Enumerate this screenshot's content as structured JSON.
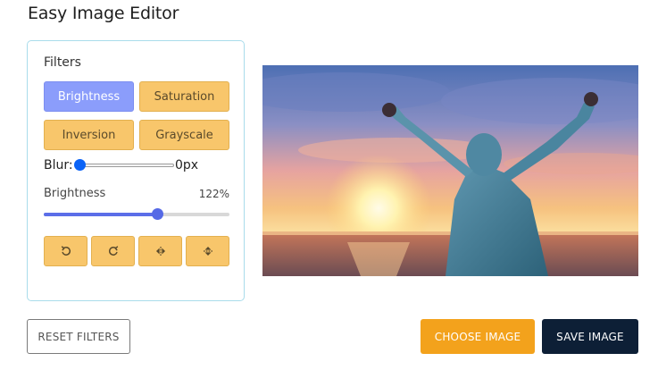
{
  "app": {
    "title": "Easy Image Editor"
  },
  "filters_panel": {
    "title": "Filters",
    "buttons": [
      {
        "label": "Brightness",
        "active": true
      },
      {
        "label": "Saturation",
        "active": false
      },
      {
        "label": "Inversion",
        "active": false
      },
      {
        "label": "Grayscale",
        "active": false
      }
    ],
    "blur": {
      "label": "Blur:",
      "value": "0px",
      "level": 0
    },
    "adjust": {
      "name": "Brightness",
      "value": "122%",
      "fraction": 0.61
    },
    "tools": [
      {
        "icon": "rotate-left-icon"
      },
      {
        "icon": "rotate-right-icon"
      },
      {
        "icon": "flip-horizontal-icon"
      },
      {
        "icon": "flip-vertical-icon"
      }
    ]
  },
  "colors": {
    "active_filter": "#8b9dfb",
    "filter_button": "#f8c66b",
    "choose_button": "#f3a21c",
    "save_button": "#0d1f36",
    "slider": "#5b6ee8"
  },
  "actions": {
    "reset_label": "RESET FILTERS",
    "choose_label": "CHOOSE IMAGE",
    "save_label": "SAVE IMAGE"
  }
}
